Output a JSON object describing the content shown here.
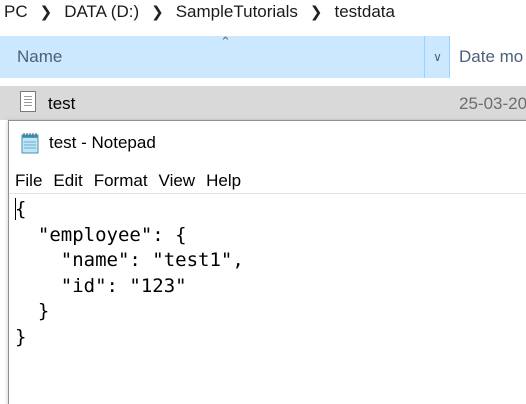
{
  "explorer": {
    "breadcrumb": [
      "PC",
      "DATA (D:)",
      "SampleTutorials",
      "testdata"
    ],
    "columns": {
      "name": "Name",
      "date_modified": "Date mo"
    },
    "file": {
      "name": "test",
      "date": "25-03-20"
    }
  },
  "notepad": {
    "title": "test - Notepad",
    "menu": [
      "File",
      "Edit",
      "Format",
      "View",
      "Help"
    ],
    "content": "{\n  \"employee\": {\n    \"name\": \"test1\",\n    \"id\": \"123\"\n  }\n}"
  },
  "icons": {
    "breadcrumb_separator": "chevron-right-icon",
    "sort": "sort-ascending-icon",
    "column_dropdown": "chevron-down-icon",
    "file": "text-file-icon",
    "app": "notepad-icon"
  },
  "colors": {
    "column_header_selected": "#cce8ff",
    "file_row_selected": "#d9d9d9"
  }
}
